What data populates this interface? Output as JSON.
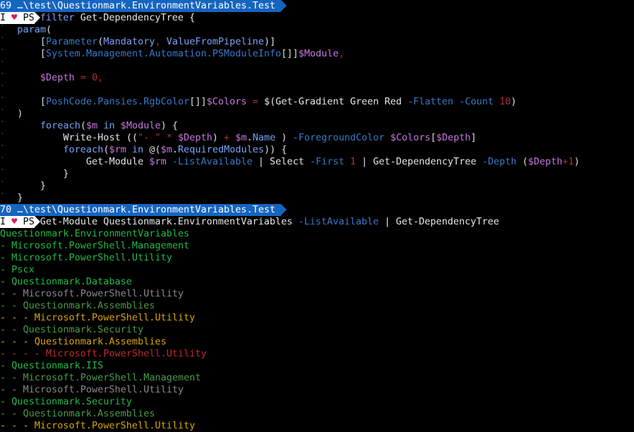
{
  "colors": {
    "background": "#000000",
    "default": "#dcdcdc",
    "keyword": "#7aa2f7",
    "type": "#3a78c8",
    "variable": "#c678dd",
    "operator": "#b03030",
    "number": "#b03030",
    "param": "#3a78c8",
    "string": "#b03030",
    "command": "#e6e6e6",
    "member": "#7aa2f7",
    "green": "#22b84a",
    "dim": "#4a9a4a",
    "gray": "#8a8a8a",
    "yellow": "#d6a60a",
    "red": "#c0282b",
    "continuation": "#444444"
  },
  "prompts": [
    {
      "hist": "69",
      "path": " …\\test\\Questionmark.EnvironmentVariables.Test "
    },
    {
      "hist": "70",
      "path": " …\\test\\Questionmark.EnvironmentVariables.Test "
    }
  ],
  "prompt_line": {
    "i": "I ",
    "heart": "♥",
    "ps": " PS"
  },
  "lines": [
    {
      "kind": "prompt1",
      "index": 0
    },
    {
      "kind": "code",
      "tokens": [
        {
          "t": "I ",
          "c": "default",
          "prompt": true
        },
        {
          "t": "filter",
          "c": "keyword"
        },
        {
          "t": " Get-DependencyTree {",
          "c": "command"
        }
      ]
    },
    {
      "kind": "code",
      "tokens": [
        {
          "t": "` ",
          "c": "continuation"
        },
        {
          "t": " param",
          "c": "keyword"
        },
        {
          "t": "(",
          "c": "default"
        }
      ]
    },
    {
      "kind": "code",
      "tokens": [
        {
          "t": "`",
          "c": "continuation"
        },
        {
          "t": "      [",
          "c": "default"
        },
        {
          "t": "Parameter",
          "c": "type"
        },
        {
          "t": "(",
          "c": "default"
        },
        {
          "t": "Mandatory",
          "c": "member"
        },
        {
          "t": ", ",
          "c": "operator"
        },
        {
          "t": "ValueFromPipeline",
          "c": "member"
        },
        {
          "t": ")]",
          "c": "default"
        }
      ]
    },
    {
      "kind": "code",
      "tokens": [
        {
          "t": "`",
          "c": "continuation"
        },
        {
          "t": "      [",
          "c": "default"
        },
        {
          "t": "System.Management.Automation.PSModuleInfo",
          "c": "type"
        },
        {
          "t": "[]]",
          "c": "default"
        },
        {
          "t": "$Module",
          "c": "variable"
        },
        {
          "t": ",",
          "c": "operator"
        }
      ]
    },
    {
      "kind": "code",
      "tokens": [
        {
          "t": "`",
          "c": "continuation"
        }
      ]
    },
    {
      "kind": "code",
      "tokens": [
        {
          "t": "`",
          "c": "continuation"
        },
        {
          "t": "      ",
          "c": "default"
        },
        {
          "t": "$Depth",
          "c": "variable"
        },
        {
          "t": " = ",
          "c": "operator"
        },
        {
          "t": "0",
          "c": "number"
        },
        {
          "t": ",",
          "c": "operator"
        }
      ]
    },
    {
      "kind": "code",
      "tokens": [
        {
          "t": "`",
          "c": "continuation"
        }
      ]
    },
    {
      "kind": "code",
      "tokens": [
        {
          "t": "`",
          "c": "continuation"
        },
        {
          "t": "      [",
          "c": "default"
        },
        {
          "t": "PoshCode.Pansies.RgbColor",
          "c": "type"
        },
        {
          "t": "[]]",
          "c": "default"
        },
        {
          "t": "$Colors",
          "c": "variable"
        },
        {
          "t": " = ",
          "c": "operator"
        },
        {
          "t": "$(Get-Gradient Green Red ",
          "c": "command"
        },
        {
          "t": "-Flatten",
          "c": "param"
        },
        {
          "t": " ",
          "c": "default"
        },
        {
          "t": "-Count",
          "c": "param"
        },
        {
          "t": " ",
          "c": "default"
        },
        {
          "t": "10",
          "c": "number"
        },
        {
          "t": ")",
          "c": "command"
        }
      ]
    },
    {
      "kind": "code",
      "tokens": [
        {
          "t": "`",
          "c": "continuation"
        },
        {
          "t": "  )",
          "c": "default"
        }
      ]
    },
    {
      "kind": "code",
      "tokens": [
        {
          "t": "`",
          "c": "continuation"
        },
        {
          "t": "      ",
          "c": "default"
        },
        {
          "t": "foreach",
          "c": "keyword"
        },
        {
          "t": "(",
          "c": "default"
        },
        {
          "t": "$m",
          "c": "variable"
        },
        {
          "t": " in ",
          "c": "keyword"
        },
        {
          "t": "$Module",
          "c": "variable"
        },
        {
          "t": ") {",
          "c": "default"
        }
      ]
    },
    {
      "kind": "code",
      "tokens": [
        {
          "t": "`",
          "c": "continuation"
        },
        {
          "t": "          Write-Host ((",
          "c": "command"
        },
        {
          "t": "\"- \"",
          "c": "string"
        },
        {
          "t": " * ",
          "c": "operator"
        },
        {
          "t": "$Depth",
          "c": "variable"
        },
        {
          "t": ") ",
          "c": "default"
        },
        {
          "t": "+",
          "c": "operator"
        },
        {
          "t": " ",
          "c": "default"
        },
        {
          "t": "$m",
          "c": "variable"
        },
        {
          "t": ".",
          "c": "default"
        },
        {
          "t": "Name",
          "c": "member"
        },
        {
          "t": " ) ",
          "c": "default"
        },
        {
          "t": "-ForegroundColor",
          "c": "param"
        },
        {
          "t": " ",
          "c": "default"
        },
        {
          "t": "$Colors",
          "c": "variable"
        },
        {
          "t": "[",
          "c": "default"
        },
        {
          "t": "$Depth",
          "c": "variable"
        },
        {
          "t": "]",
          "c": "default"
        }
      ]
    },
    {
      "kind": "code",
      "tokens": [
        {
          "t": "`",
          "c": "continuation"
        },
        {
          "t": "          ",
          "c": "default"
        },
        {
          "t": "foreach",
          "c": "keyword"
        },
        {
          "t": "(",
          "c": "default"
        },
        {
          "t": "$rm",
          "c": "variable"
        },
        {
          "t": " in ",
          "c": "keyword"
        },
        {
          "t": "@(",
          "c": "default"
        },
        {
          "t": "$m",
          "c": "variable"
        },
        {
          "t": ".",
          "c": "default"
        },
        {
          "t": "RequiredModules",
          "c": "member"
        },
        {
          "t": ")) {",
          "c": "default"
        }
      ]
    },
    {
      "kind": "code",
      "tokens": [
        {
          "t": "`",
          "c": "continuation"
        },
        {
          "t": "              Get-Module ",
          "c": "command"
        },
        {
          "t": "$rm",
          "c": "variable"
        },
        {
          "t": " ",
          "c": "default"
        },
        {
          "t": "-ListAvailable",
          "c": "param"
        },
        {
          "t": " | Select ",
          "c": "command"
        },
        {
          "t": "-First",
          "c": "param"
        },
        {
          "t": " ",
          "c": "default"
        },
        {
          "t": "1",
          "c": "number"
        },
        {
          "t": " | Get-DependencyTree ",
          "c": "command"
        },
        {
          "t": "-Depth",
          "c": "param"
        },
        {
          "t": " (",
          "c": "default"
        },
        {
          "t": "$Depth",
          "c": "variable"
        },
        {
          "t": "+",
          "c": "operator"
        },
        {
          "t": "1",
          "c": "number"
        },
        {
          "t": ")",
          "c": "default"
        }
      ]
    },
    {
      "kind": "code",
      "tokens": [
        {
          "t": "`",
          "c": "continuation"
        },
        {
          "t": "          }",
          "c": "default"
        }
      ]
    },
    {
      "kind": "code",
      "tokens": [
        {
          "t": "`",
          "c": "continuation"
        },
        {
          "t": "      }",
          "c": "default"
        }
      ]
    },
    {
      "kind": "code",
      "tokens": [
        {
          "t": "`",
          "c": "continuation"
        },
        {
          "t": "  }",
          "c": "default"
        }
      ]
    },
    {
      "kind": "prompt1",
      "index": 1
    },
    {
      "kind": "code",
      "tokens": [
        {
          "t": "I ",
          "c": "default",
          "prompt": true
        },
        {
          "t": "Get-Module Questionmark.EnvironmentVariables ",
          "c": "command"
        },
        {
          "t": "-ListAvailable",
          "c": "param"
        },
        {
          "t": " | Get-DependencyTree",
          "c": "command"
        }
      ]
    },
    {
      "kind": "code",
      "tokens": [
        {
          "t": "Questionmark.EnvironmentVariables",
          "c": "green"
        }
      ]
    },
    {
      "kind": "code",
      "tokens": [
        {
          "t": "- Microsoft.PowerShell.Management",
          "c": "green"
        }
      ]
    },
    {
      "kind": "code",
      "tokens": [
        {
          "t": "- Microsoft.PowerShell.Utility",
          "c": "green"
        }
      ]
    },
    {
      "kind": "code",
      "tokens": [
        {
          "t": "- Pscx",
          "c": "green"
        }
      ]
    },
    {
      "kind": "code",
      "tokens": [
        {
          "t": "- Questionmark.Database",
          "c": "green"
        }
      ]
    },
    {
      "kind": "code",
      "tokens": [
        {
          "t": "- - Microsoft.PowerShell.Utility",
          "c": "gray"
        }
      ]
    },
    {
      "kind": "code",
      "tokens": [
        {
          "t": "- - Questionmark.Assemblies",
          "c": "dim"
        }
      ]
    },
    {
      "kind": "code",
      "tokens": [
        {
          "t": "- - - Microsoft.PowerShell.Utility",
          "c": "yellow"
        }
      ]
    },
    {
      "kind": "code",
      "tokens": [
        {
          "t": "- - Questionmark.Security",
          "c": "dim"
        }
      ]
    },
    {
      "kind": "code",
      "tokens": [
        {
          "t": "- - - Questionmark.Assemblies",
          "c": "yellow"
        }
      ]
    },
    {
      "kind": "code",
      "tokens": [
        {
          "t": "- - - - Microsoft.PowerShell.Utility",
          "c": "red"
        }
      ]
    },
    {
      "kind": "code",
      "tokens": [
        {
          "t": "- Questionmark.IIS",
          "c": "green"
        }
      ]
    },
    {
      "kind": "code",
      "tokens": [
        {
          "t": "- - Microsoft.PowerShell.Management",
          "c": "dim"
        }
      ]
    },
    {
      "kind": "code",
      "tokens": [
        {
          "t": "- - Microsoft.PowerShell.Utility",
          "c": "gray"
        }
      ]
    },
    {
      "kind": "code",
      "tokens": [
        {
          "t": "- Questionmark.Security",
          "c": "green"
        }
      ]
    },
    {
      "kind": "code",
      "tokens": [
        {
          "t": "- - Questionmark.Assemblies",
          "c": "dim"
        }
      ]
    },
    {
      "kind": "code",
      "tokens": [
        {
          "t": "- - - Microsoft.PowerShell.Utility",
          "c": "yellow"
        }
      ]
    }
  ]
}
